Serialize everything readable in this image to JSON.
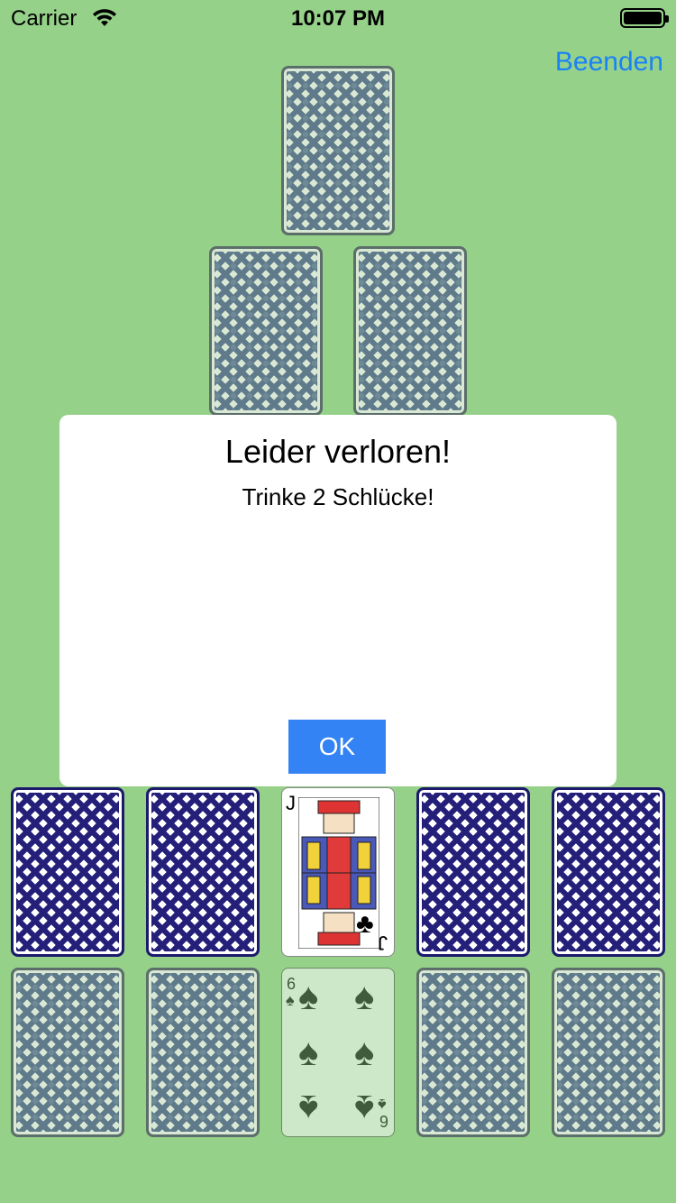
{
  "status_bar": {
    "carrier": "Carrier",
    "time": "10:07 PM",
    "battery_level": 1.0
  },
  "header": {
    "quit_label": "Beenden",
    "quit_color": "#1a82f5"
  },
  "pyramid": {
    "rows": [
      {
        "cards": [
          "back"
        ]
      },
      {
        "cards": [
          "back",
          "back"
        ]
      }
    ]
  },
  "player_row_1": {
    "cards": [
      {
        "face": "back-blue"
      },
      {
        "face": "back-blue"
      },
      {
        "face": "up",
        "rank": "J",
        "suit": "clubs",
        "suit_symbol": "♣"
      },
      {
        "face": "back-blue"
      },
      {
        "face": "back-blue"
      }
    ]
  },
  "player_row_2": {
    "cards": [
      {
        "face": "back"
      },
      {
        "face": "back"
      },
      {
        "face": "up",
        "rank": "6",
        "suit": "spades",
        "suit_symbol": "♠"
      },
      {
        "face": "back"
      },
      {
        "face": "back"
      }
    ]
  },
  "dialog": {
    "title": "Leider verloren!",
    "message": "Trinke 2 Schlücke!",
    "ok_label": "OK",
    "button_color": "#3483f5"
  },
  "colors": {
    "table_background": "#96d18a",
    "card_back_green": "#5f7a8a",
    "card_back_blue": "#24207a"
  }
}
